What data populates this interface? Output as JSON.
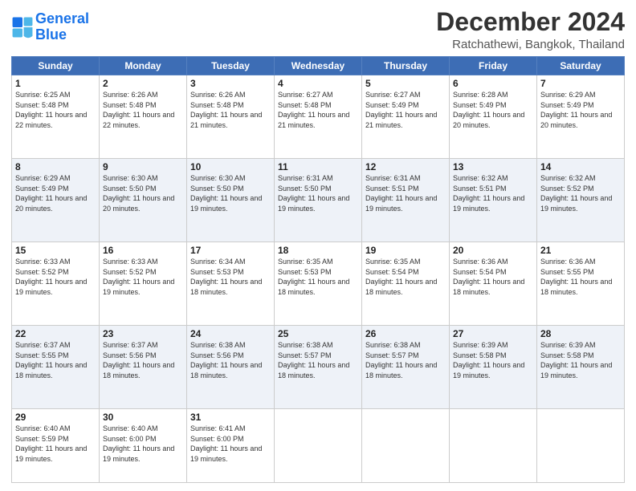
{
  "header": {
    "logo_line1": "General",
    "logo_line2": "Blue",
    "title": "December 2024",
    "subtitle": "Ratchathewi, Bangkok, Thailand"
  },
  "weekdays": [
    "Sunday",
    "Monday",
    "Tuesday",
    "Wednesday",
    "Thursday",
    "Friday",
    "Saturday"
  ],
  "weeks": [
    [
      {
        "day": "1",
        "sunrise": "6:25 AM",
        "sunset": "5:48 PM",
        "daylight": "11 hours and 22 minutes."
      },
      {
        "day": "2",
        "sunrise": "6:26 AM",
        "sunset": "5:48 PM",
        "daylight": "11 hours and 22 minutes."
      },
      {
        "day": "3",
        "sunrise": "6:26 AM",
        "sunset": "5:48 PM",
        "daylight": "11 hours and 21 minutes."
      },
      {
        "day": "4",
        "sunrise": "6:27 AM",
        "sunset": "5:48 PM",
        "daylight": "11 hours and 21 minutes."
      },
      {
        "day": "5",
        "sunrise": "6:27 AM",
        "sunset": "5:49 PM",
        "daylight": "11 hours and 21 minutes."
      },
      {
        "day": "6",
        "sunrise": "6:28 AM",
        "sunset": "5:49 PM",
        "daylight": "11 hours and 20 minutes."
      },
      {
        "day": "7",
        "sunrise": "6:29 AM",
        "sunset": "5:49 PM",
        "daylight": "11 hours and 20 minutes."
      }
    ],
    [
      {
        "day": "8",
        "sunrise": "6:29 AM",
        "sunset": "5:49 PM",
        "daylight": "11 hours and 20 minutes."
      },
      {
        "day": "9",
        "sunrise": "6:30 AM",
        "sunset": "5:50 PM",
        "daylight": "11 hours and 20 minutes."
      },
      {
        "day": "10",
        "sunrise": "6:30 AM",
        "sunset": "5:50 PM",
        "daylight": "11 hours and 19 minutes."
      },
      {
        "day": "11",
        "sunrise": "6:31 AM",
        "sunset": "5:50 PM",
        "daylight": "11 hours and 19 minutes."
      },
      {
        "day": "12",
        "sunrise": "6:31 AM",
        "sunset": "5:51 PM",
        "daylight": "11 hours and 19 minutes."
      },
      {
        "day": "13",
        "sunrise": "6:32 AM",
        "sunset": "5:51 PM",
        "daylight": "11 hours and 19 minutes."
      },
      {
        "day": "14",
        "sunrise": "6:32 AM",
        "sunset": "5:52 PM",
        "daylight": "11 hours and 19 minutes."
      }
    ],
    [
      {
        "day": "15",
        "sunrise": "6:33 AM",
        "sunset": "5:52 PM",
        "daylight": "11 hours and 19 minutes."
      },
      {
        "day": "16",
        "sunrise": "6:33 AM",
        "sunset": "5:52 PM",
        "daylight": "11 hours and 19 minutes."
      },
      {
        "day": "17",
        "sunrise": "6:34 AM",
        "sunset": "5:53 PM",
        "daylight": "11 hours and 18 minutes."
      },
      {
        "day": "18",
        "sunrise": "6:35 AM",
        "sunset": "5:53 PM",
        "daylight": "11 hours and 18 minutes."
      },
      {
        "day": "19",
        "sunrise": "6:35 AM",
        "sunset": "5:54 PM",
        "daylight": "11 hours and 18 minutes."
      },
      {
        "day": "20",
        "sunrise": "6:36 AM",
        "sunset": "5:54 PM",
        "daylight": "11 hours and 18 minutes."
      },
      {
        "day": "21",
        "sunrise": "6:36 AM",
        "sunset": "5:55 PM",
        "daylight": "11 hours and 18 minutes."
      }
    ],
    [
      {
        "day": "22",
        "sunrise": "6:37 AM",
        "sunset": "5:55 PM",
        "daylight": "11 hours and 18 minutes."
      },
      {
        "day": "23",
        "sunrise": "6:37 AM",
        "sunset": "5:56 PM",
        "daylight": "11 hours and 18 minutes."
      },
      {
        "day": "24",
        "sunrise": "6:38 AM",
        "sunset": "5:56 PM",
        "daylight": "11 hours and 18 minutes."
      },
      {
        "day": "25",
        "sunrise": "6:38 AM",
        "sunset": "5:57 PM",
        "daylight": "11 hours and 18 minutes."
      },
      {
        "day": "26",
        "sunrise": "6:38 AM",
        "sunset": "5:57 PM",
        "daylight": "11 hours and 18 minutes."
      },
      {
        "day": "27",
        "sunrise": "6:39 AM",
        "sunset": "5:58 PM",
        "daylight": "11 hours and 19 minutes."
      },
      {
        "day": "28",
        "sunrise": "6:39 AM",
        "sunset": "5:58 PM",
        "daylight": "11 hours and 19 minutes."
      }
    ],
    [
      {
        "day": "29",
        "sunrise": "6:40 AM",
        "sunset": "5:59 PM",
        "daylight": "11 hours and 19 minutes."
      },
      {
        "day": "30",
        "sunrise": "6:40 AM",
        "sunset": "6:00 PM",
        "daylight": "11 hours and 19 minutes."
      },
      {
        "day": "31",
        "sunrise": "6:41 AM",
        "sunset": "6:00 PM",
        "daylight": "11 hours and 19 minutes."
      },
      null,
      null,
      null,
      null
    ]
  ]
}
